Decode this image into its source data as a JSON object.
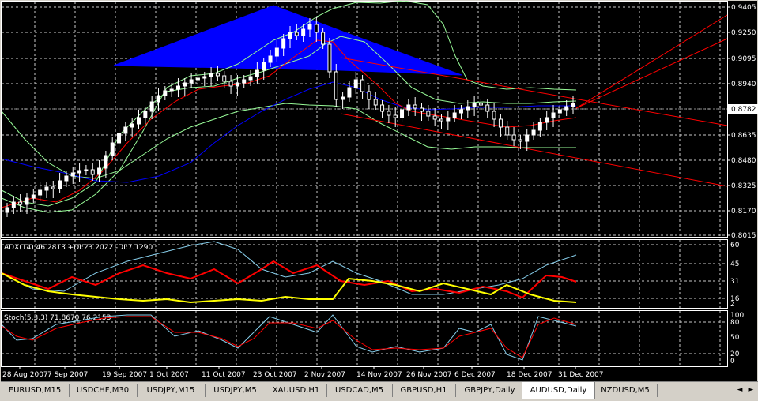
{
  "indicators": {
    "adx_label": "ADX(14) 46.2813 +DI:23.2022 -DI:7.1290",
    "stoch_label": "Stoch(5,3,3) 71.8670 76.2153"
  },
  "price_axis": [
    "0.9405",
    "0.9250",
    "0.9095",
    "0.8940",
    "0.8782",
    "0.8635",
    "0.8480",
    "0.8325",
    "0.8170",
    "0.8015"
  ],
  "current_price": "0.8782",
  "adx_axis": [
    "60",
    "45",
    "31",
    "16",
    "2"
  ],
  "stoch_axis": [
    "100",
    "80",
    "50",
    "20",
    "0"
  ],
  "dates": [
    "28 Aug 2007",
    "7 Sep 2007",
    "19 Sep 2007",
    "1 Oct 2007",
    "11 Oct 2007",
    "23 Oct 2007",
    "2 Nov 2007",
    "14 Nov 2007",
    "26 Nov 2007",
    "6 Dec 2007",
    "18 Dec 2007",
    "31 Dec 2007"
  ],
  "tabs": [
    {
      "label": "EURUSD,M15",
      "active": false
    },
    {
      "label": "USDCHF,M30",
      "active": false
    },
    {
      "label": "USDJPY,M15",
      "active": false
    },
    {
      "label": "USDJPY,M5",
      "active": false
    },
    {
      "label": "XAUUSD,H1",
      "active": false
    },
    {
      "label": "USDCAD,M5",
      "active": false
    },
    {
      "label": "GBPUSD,H1",
      "active": false
    },
    {
      "label": "GBPJPY,Daily",
      "active": false
    },
    {
      "label": "AUDUSD,Daily",
      "active": true
    },
    {
      "label": "NZDUSD,M5",
      "active": false
    }
  ],
  "colors": {
    "background": "#000000",
    "grid": "#c8c8c8",
    "candle_bull": "#ffffff",
    "candle_bear": "#ffffff",
    "bands": "#98fb98",
    "ma_red": "#ff0000",
    "ma_blue": "#0000ff",
    "triangle": "#0000ff",
    "adx": "#87ceeb",
    "plus_di": "#ff0000",
    "minus_di": "#ffff00",
    "stoch_main": "#87ceeb",
    "stoch_signal": "#ff0000"
  }
}
